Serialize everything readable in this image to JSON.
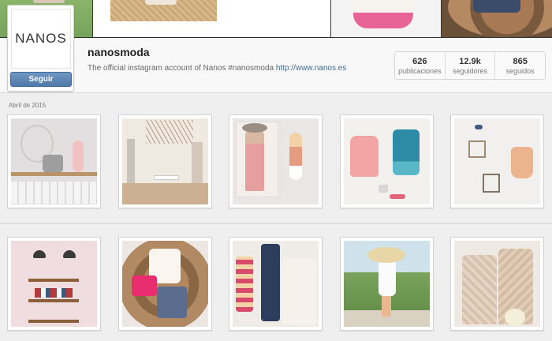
{
  "profile": {
    "avatar_text": "NANOS",
    "follow_label": "Seguir",
    "username": "nanosmoda",
    "bio_text": "The official instagram account of Nanos #nanosmoda ",
    "bio_link": "http://www.nanos.es"
  },
  "stats": [
    {
      "num": "626",
      "label": "publicaciones"
    },
    {
      "num": "12.9k",
      "label": "seguidores"
    },
    {
      "num": "865",
      "label": "seguidos"
    }
  ],
  "feed": {
    "section_label": "Abril de 2015"
  },
  "colors": {
    "link": "#3f6a97",
    "button": "#4f79a8",
    "background": "#efefef"
  }
}
